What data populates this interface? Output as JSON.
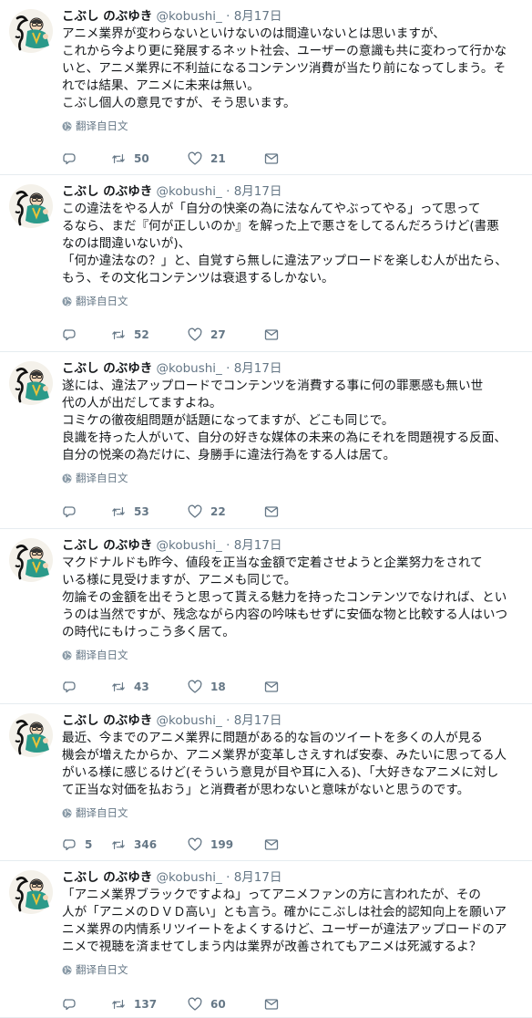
{
  "colors": {
    "secondary": "#657786",
    "text": "#14171a",
    "border": "#e6ecf0"
  },
  "tweets": [
    {
      "name": "こぶし のぶゆき",
      "handle": "@kobushi_",
      "sep": "·",
      "date": "8月17日",
      "text": "アニメ業界が変わらないといけないのは間違いないとは思いますが、\nこれから今より更に発展するネット社会、ユーザーの意識も共に変わって行かな\nいと、アニメ業界に不利益になるコンテンツ消費が当たり前になってしまう。そ\nれでは結果、アニメに未来は無い。\nこぶし個人の意見ですが、そう思います。",
      "translate": "翻译自日文",
      "replies": "",
      "retweets": "50",
      "likes": "21"
    },
    {
      "name": "こぶし のぶゆき",
      "handle": "@kobushi_",
      "sep": "·",
      "date": "8月17日",
      "text": "この違法をやる人が「自分の快楽の為に法なんてやぶってやる」って思って\nるなら、まだ『何が正しいのか』を解った上で悪さをしてるんだろうけど(書悪\nなのは間違いないが)、\n「何か違法なの？」と、自覚すら無しに違法アップロードを楽しむ人が出たら、\nもう、その文化コンテンツは衰退するしかない。",
      "translate": "翻译自日文",
      "replies": "",
      "retweets": "52",
      "likes": "27"
    },
    {
      "name": "こぶし のぶゆき",
      "handle": "@kobushi_",
      "sep": "·",
      "date": "8月17日",
      "text": "遂には、違法アップロードでコンテンツを消費する事に何の罪悪感も無い世\n代の人が出だしてますよね。\nコミケの徹夜組問題が話題になってますが、どこも同じで。\n良識を持った人がいて、自分の好きな媒体の未来の為にそれを問題視する反面、\n自分の悦楽の為だけに、身勝手に違法行為をする人は居て。",
      "translate": "翻译自日文",
      "replies": "",
      "retweets": "53",
      "likes": "22"
    },
    {
      "name": "こぶし のぶゆき",
      "handle": "@kobushi_",
      "sep": "·",
      "date": "8月17日",
      "text": "マクドナルドも昨今、値段を正当な金額で定着させようと企業努力をされて\nいる様に見受けますが、アニメも同じで。\n勿論その金額を出そうと思って貰える魅力を持ったコンテンツでなければ、とい\nうのは当然ですが、残念ながら内容の吟味もせずに安価な物と比較する人はいつ\nの時代にもけっこう多く居て。",
      "translate": "翻译自日文",
      "replies": "",
      "retweets": "43",
      "likes": "18"
    },
    {
      "name": "こぶし のぶゆき",
      "handle": "@kobushi_",
      "sep": "·",
      "date": "8月17日",
      "text": "最近、今までのアニメ業界に問題がある的な旨のツイートを多くの人が見る\n機会が増えたからか、アニメ業界が変革しさえすれば安泰、みたいに思ってる人\nがいる様に感じるけど(そういう意見が目や耳に入る)、「大好きなアニメに対し\nて正当な対価を払おう」と消費者が思わないと意味がないと思うのです。",
      "translate": "翻译自日文",
      "replies": "5",
      "retweets": "346",
      "likes": "199"
    },
    {
      "name": "こぶし のぶゆき",
      "handle": "@kobushi_",
      "sep": "·",
      "date": "8月17日",
      "text": "「アニメ業界ブラックですよね」ってアニメファンの方に言われたが、その\n人が「アニメのＤＶＤ高い」とも言う。確かにこぶしは社会的認知向上を願いア\nニメ業界の内情系リツイートをよくするけど、ユーザーが違法アップロードのア\nニメで視聴を済ませてしまう内は業界が改善されてもアニメは死滅するよ？",
      "translate": "翻译自日文",
      "replies": "",
      "retweets": "137",
      "likes": "60"
    }
  ]
}
